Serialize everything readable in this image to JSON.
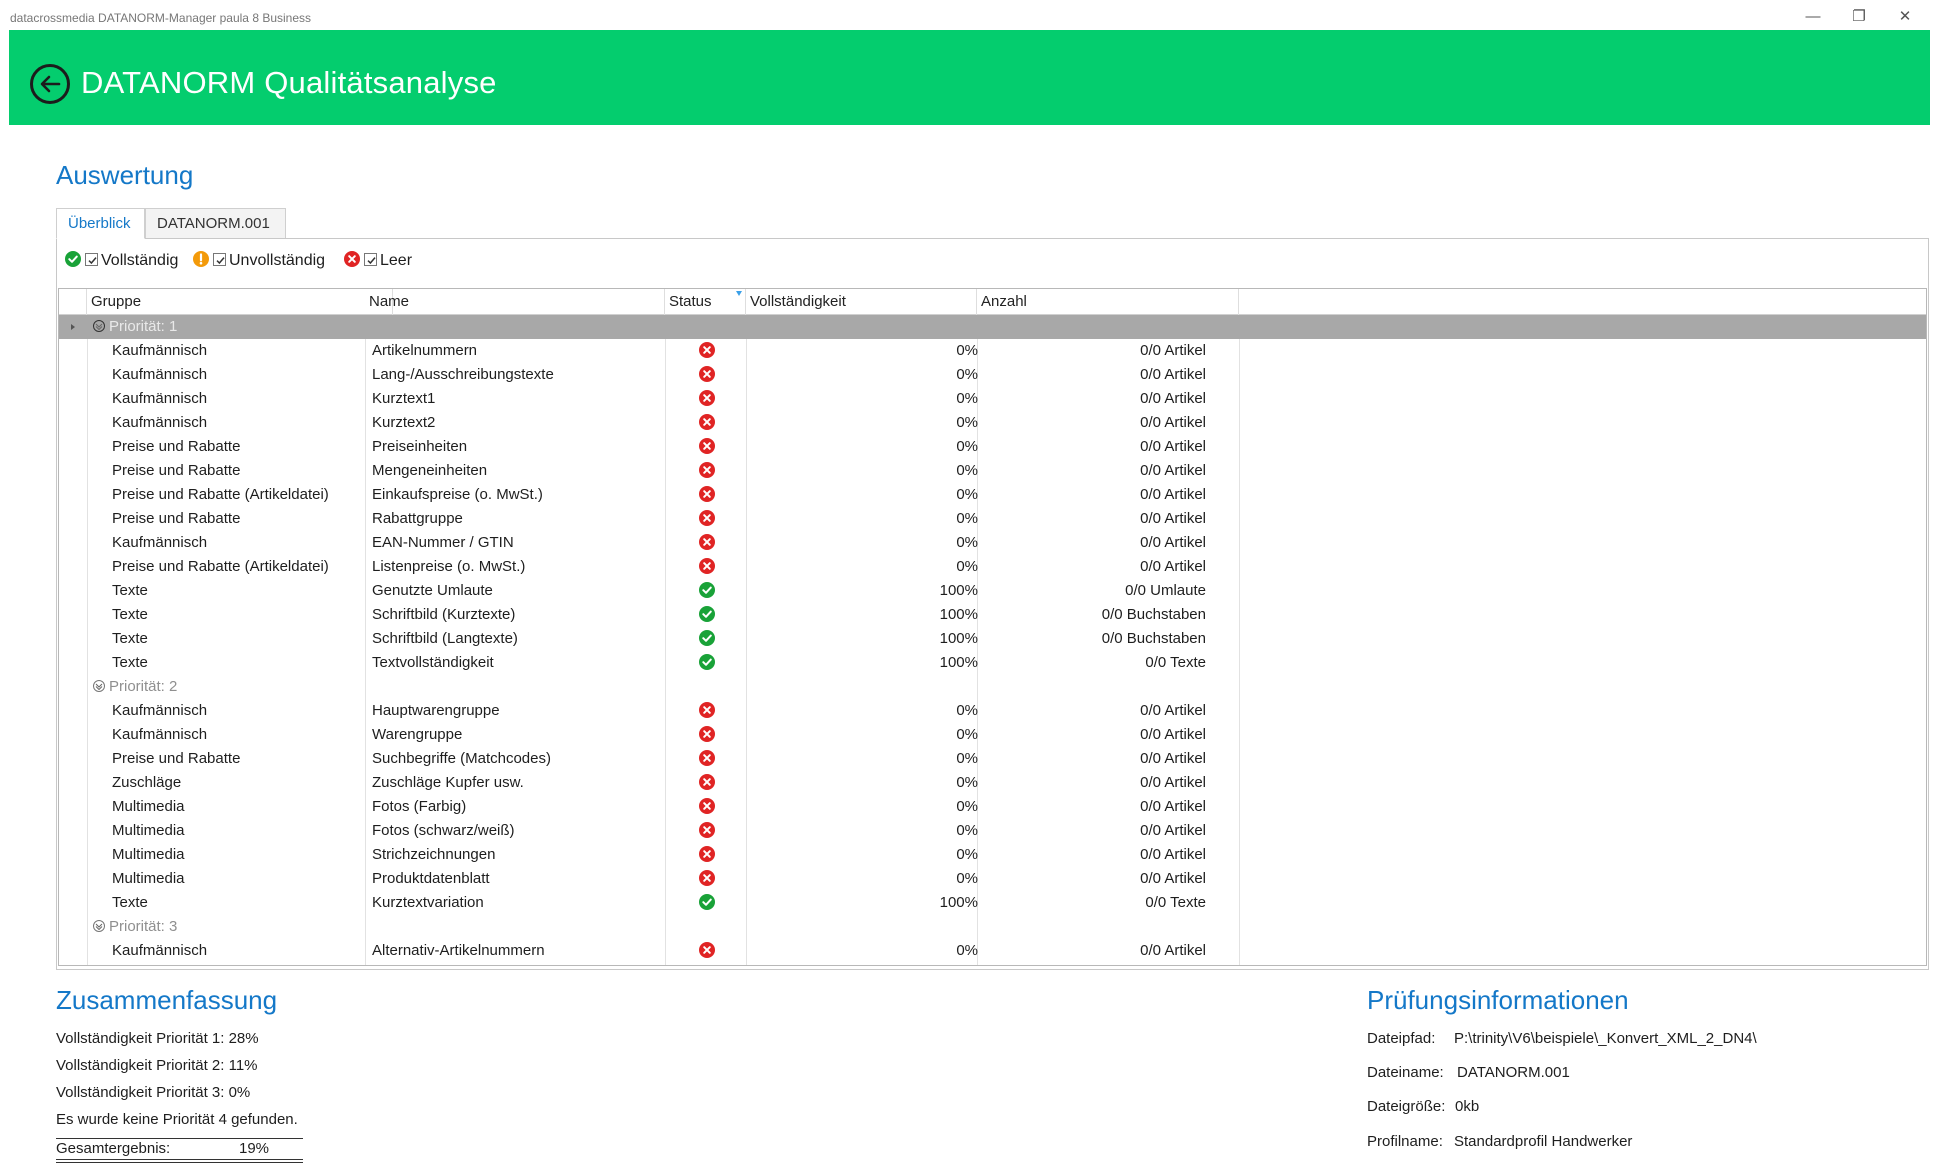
{
  "window": {
    "title": "datacrossmedia DATANORM-Manager paula 8 Business",
    "controls": [
      "—",
      "❐",
      "✕"
    ]
  },
  "header": {
    "title": "DATANORM Qualitätsanalyse"
  },
  "auswertung": {
    "title": "Auswertung",
    "tabs": [
      {
        "label": "Überblick",
        "active": true
      },
      {
        "label": "DATANORM.001",
        "active": false
      }
    ],
    "filters": [
      {
        "label": "Vollständig",
        "icon": "check-circle-icon",
        "checked": true
      },
      {
        "label": "Unvollständig",
        "icon": "warning-circle-icon",
        "checked": true
      },
      {
        "label": "Leer",
        "icon": "error-circle-icon",
        "checked": true
      }
    ],
    "columns": {
      "gruppe": "Gruppe",
      "name": "Name",
      "status": "Status",
      "voll": "Vollständigkeit",
      "anzahl": "Anzahl"
    },
    "groups": [
      {
        "label": "Priorität: 1",
        "selected": true,
        "rows": [
          {
            "gruppe": "Kaufmännisch",
            "name": "Artikelnummern",
            "status": "error",
            "voll": "0%",
            "anzahl": "0/0 Artikel"
          },
          {
            "gruppe": "Kaufmännisch",
            "name": "Lang-/Ausschreibungstexte",
            "status": "error",
            "voll": "0%",
            "anzahl": "0/0 Artikel"
          },
          {
            "gruppe": "Kaufmännisch",
            "name": "Kurztext1",
            "status": "error",
            "voll": "0%",
            "anzahl": "0/0 Artikel"
          },
          {
            "gruppe": "Kaufmännisch",
            "name": "Kurztext2",
            "status": "error",
            "voll": "0%",
            "anzahl": "0/0 Artikel"
          },
          {
            "gruppe": "Preise und Rabatte",
            "name": "Preiseinheiten",
            "status": "error",
            "voll": "0%",
            "anzahl": "0/0 Artikel"
          },
          {
            "gruppe": "Preise und Rabatte",
            "name": "Mengeneinheiten",
            "status": "error",
            "voll": "0%",
            "anzahl": "0/0 Artikel"
          },
          {
            "gruppe": "Preise und Rabatte (Artikeldatei)",
            "name": "Einkaufspreise (o. MwSt.)",
            "status": "error",
            "voll": "0%",
            "anzahl": "0/0 Artikel"
          },
          {
            "gruppe": "Preise und Rabatte",
            "name": "Rabattgruppe",
            "status": "error",
            "voll": "0%",
            "anzahl": "0/0 Artikel"
          },
          {
            "gruppe": "Kaufmännisch",
            "name": "EAN-Nummer / GTIN",
            "status": "error",
            "voll": "0%",
            "anzahl": "0/0 Artikel"
          },
          {
            "gruppe": "Preise und Rabatte (Artikeldatei)",
            "name": "Listenpreise (o. MwSt.)",
            "status": "error",
            "voll": "0%",
            "anzahl": "0/0 Artikel"
          },
          {
            "gruppe": "Texte",
            "name": "Genutzte Umlaute",
            "status": "ok",
            "voll": "100%",
            "anzahl": "0/0 Umlaute"
          },
          {
            "gruppe": "Texte",
            "name": "Schriftbild (Kurztexte)",
            "status": "ok",
            "voll": "100%",
            "anzahl": "0/0 Buchstaben"
          },
          {
            "gruppe": "Texte",
            "name": "Schriftbild (Langtexte)",
            "status": "ok",
            "voll": "100%",
            "anzahl": "0/0 Buchstaben"
          },
          {
            "gruppe": "Texte",
            "name": "Textvollständigkeit",
            "status": "ok",
            "voll": "100%",
            "anzahl": "0/0 Texte"
          }
        ]
      },
      {
        "label": "Priorität: 2",
        "selected": false,
        "rows": [
          {
            "gruppe": "Kaufmännisch",
            "name": "Hauptwarengruppe",
            "status": "error",
            "voll": "0%",
            "anzahl": "0/0 Artikel"
          },
          {
            "gruppe": "Kaufmännisch",
            "name": "Warengruppe",
            "status": "error",
            "voll": "0%",
            "anzahl": "0/0 Artikel"
          },
          {
            "gruppe": "Preise und Rabatte",
            "name": "Suchbegriffe (Matchcodes)",
            "status": "error",
            "voll": "0%",
            "anzahl": "0/0 Artikel"
          },
          {
            "gruppe": "Zuschläge",
            "name": "Zuschläge Kupfer usw.",
            "status": "error",
            "voll": "0%",
            "anzahl": "0/0 Artikel"
          },
          {
            "gruppe": "Multimedia",
            "name": "Fotos (Farbig)",
            "status": "error",
            "voll": "0%",
            "anzahl": "0/0 Artikel"
          },
          {
            "gruppe": "Multimedia",
            "name": "Fotos (schwarz/weiß)",
            "status": "error",
            "voll": "0%",
            "anzahl": "0/0 Artikel"
          },
          {
            "gruppe": "Multimedia",
            "name": "Strichzeichnungen",
            "status": "error",
            "voll": "0%",
            "anzahl": "0/0 Artikel"
          },
          {
            "gruppe": "Multimedia",
            "name": "Produktdatenblatt",
            "status": "error",
            "voll": "0%",
            "anzahl": "0/0 Artikel"
          },
          {
            "gruppe": "Texte",
            "name": "Kurztextvariation",
            "status": "ok",
            "voll": "100%",
            "anzahl": "0/0 Texte"
          }
        ]
      },
      {
        "label": "Priorität: 3",
        "selected": false,
        "rows": [
          {
            "gruppe": "Kaufmännisch",
            "name": "Alternativ-Artikelnummern",
            "status": "error",
            "voll": "0%",
            "anzahl": "0/0 Artikel"
          }
        ]
      }
    ]
  },
  "zusammenfassung": {
    "title": "Zusammenfassung",
    "lines": [
      "Vollständigkeit Priorität 1: 28%",
      "Vollständigkeit Priorität 2: 11%",
      "Vollständigkeit Priorität 3: 0%",
      "Es wurde keine Priorität 4 gefunden."
    ],
    "gesamt_label": "Gesamtergebnis:",
    "gesamt_value": "19%"
  },
  "pruefung": {
    "title": "Prüfungsinformationen",
    "items": [
      {
        "label": "Dateipfad:",
        "value": "P:\\trinity\\V6\\beispiele\\_Konvert_XML_2_DN4\\"
      },
      {
        "label": "Dateiname:",
        "value": "DATANORM.001"
      },
      {
        "label": "Dateigröße:",
        "value": "0kb"
      },
      {
        "label": "Profilname:",
        "value": "Standardprofil Handwerker"
      }
    ]
  },
  "colors": {
    "header_bg": "#04cd6e",
    "accent_blue": "#1478c8",
    "status_ok": "#19a238",
    "status_error": "#e02424",
    "status_warn": "#f39a0a",
    "selected_group_bg": "#a8a8a8"
  }
}
